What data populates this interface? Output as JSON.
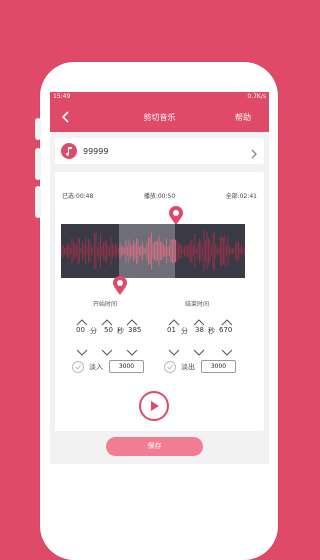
{
  "status": {
    "time": "15:49",
    "speed": "0.7K/s"
  },
  "appbar": {
    "title": "剪切音乐",
    "help": "帮助"
  },
  "song": {
    "name": "99999"
  },
  "times": {
    "selected": "已选:00:48",
    "playing": "播放:00:50",
    "total": "全部:02:41"
  },
  "start": {
    "label": "开始时间",
    "min": "00",
    "min_unit": "分",
    "sec": "50",
    "sec_unit": "秒",
    "ms": "385"
  },
  "end": {
    "label": "结束时间",
    "min": "01",
    "min_unit": "分",
    "sec": "38",
    "sec_unit": "秒",
    "ms": "670"
  },
  "fade_in": {
    "label": "淡入",
    "value": "3000"
  },
  "fade_out": {
    "label": "淡出",
    "value": "3000"
  },
  "save_label": "保存",
  "colors": {
    "brand": "#e04a69"
  },
  "icons": [
    "back-arrow-icon",
    "music-note-icon",
    "chevron-right-icon",
    "location-pin-icon",
    "chevron-up-icon",
    "chevron-down-icon",
    "check-icon",
    "play-icon"
  ]
}
